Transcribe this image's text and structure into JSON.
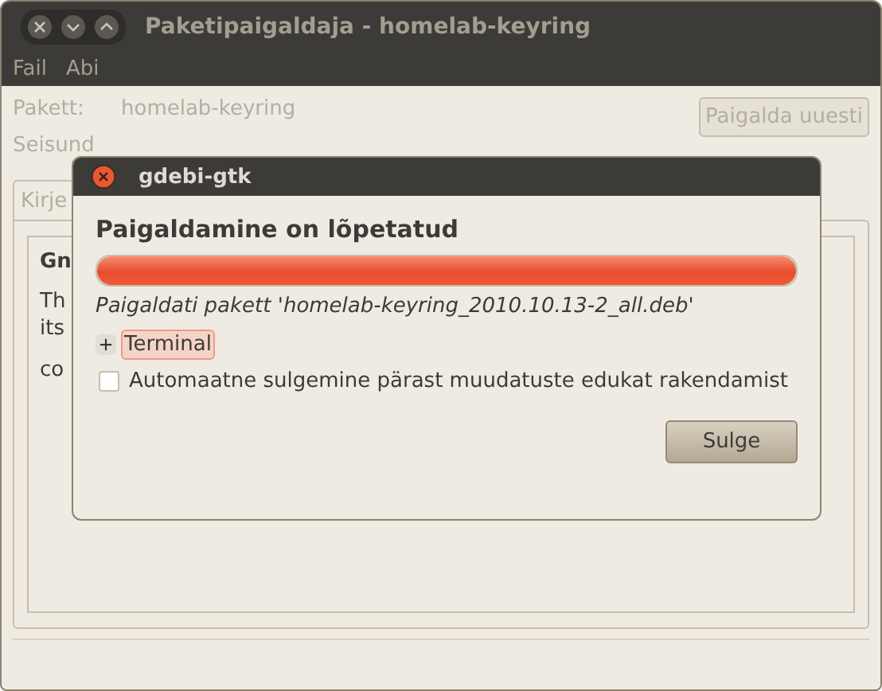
{
  "window": {
    "title": "Paketipaigaldaja - homelab-keyring"
  },
  "menu": [
    {
      "label": "Fail"
    },
    {
      "label": "Abi"
    }
  ],
  "fields": [
    {
      "label": "Pakett:",
      "value": "homelab-keyring"
    },
    {
      "label": "Seisund"
    }
  ],
  "reinstall_button": "Paigalda uuesti",
  "tabs": [
    {
      "label": "Kirje"
    }
  ],
  "description": {
    "heading": "Gn",
    "lines": [
      "Th",
      "its",
      "co"
    ]
  },
  "dialog": {
    "title": "gdebi-gtk",
    "heading": "Paigaldamine on lõpetatud",
    "progress": {
      "level": 1
    },
    "message": "Paigaldati pakett 'homelab-keyring_2010.10.13-2_all.deb'",
    "expander": {
      "label": "Terminal",
      "expanded": false
    },
    "auto_close": {
      "label": "Automaatne sulgemine pärast muudatuste edukat rakendamist",
      "checked": false
    },
    "button": "Sulge"
  }
}
